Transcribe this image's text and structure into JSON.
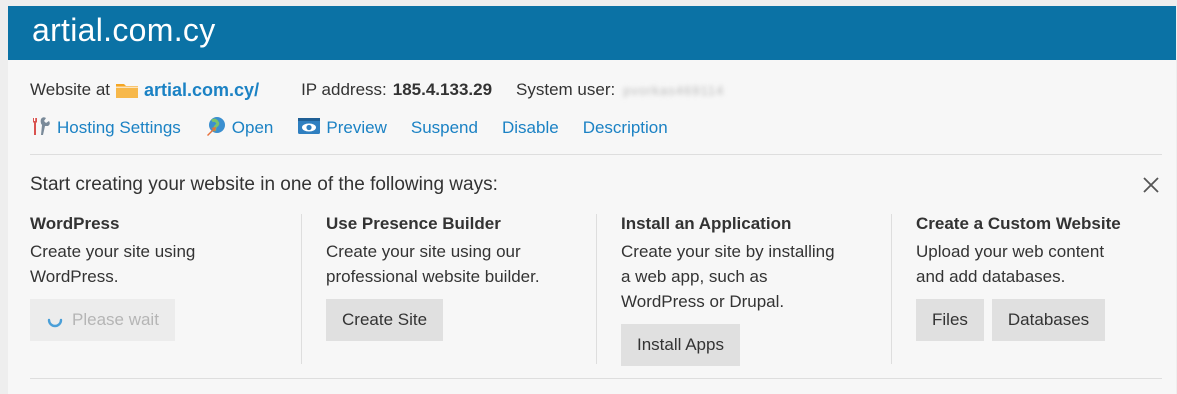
{
  "header": {
    "title": "artial.com.cy"
  },
  "website_info": {
    "label": "Website at",
    "domain": "artial.com.cy/",
    "ip_label": "IP address:",
    "ip_value": "185.4.133.29",
    "system_user_label": "System user:",
    "system_user_value": "pvorkas469114"
  },
  "links": [
    {
      "label": "Hosting Settings",
      "icon": "wrench-icon"
    },
    {
      "label": "Open",
      "icon": "globe-open-icon"
    },
    {
      "label": "Preview",
      "icon": "preview-eye-icon"
    },
    {
      "label": "Suspend"
    },
    {
      "label": "Disable"
    },
    {
      "label": "Description"
    }
  ],
  "start": {
    "title": "Start creating your website in one of the following ways:"
  },
  "options": [
    {
      "title": "WordPress",
      "desc_lines": [
        "Create your site using",
        "WordPress."
      ],
      "buttons": [
        {
          "label": "Please wait",
          "disabled": true
        }
      ]
    },
    {
      "title": "Use Presence Builder",
      "desc_lines": [
        "Create your site using our",
        "professional website builder."
      ],
      "buttons": [
        {
          "label": "Create Site"
        }
      ]
    },
    {
      "title": "Install an Application",
      "desc_lines": [
        "Create your site by installing",
        "a web app, such as",
        "WordPress or Drupal."
      ],
      "buttons": [
        {
          "label": "Install Apps"
        }
      ]
    },
    {
      "title": "Create a Custom Website",
      "desc_lines": [
        "Upload your web content",
        "and add databases."
      ],
      "buttons": [
        {
          "label": "Files"
        },
        {
          "label": "Databases"
        }
      ]
    }
  ],
  "colors": {
    "header_bg": "#0b72a5",
    "link": "#1b82c4",
    "button_bg": "#e0e0e0",
    "folder": "#f5a623"
  }
}
